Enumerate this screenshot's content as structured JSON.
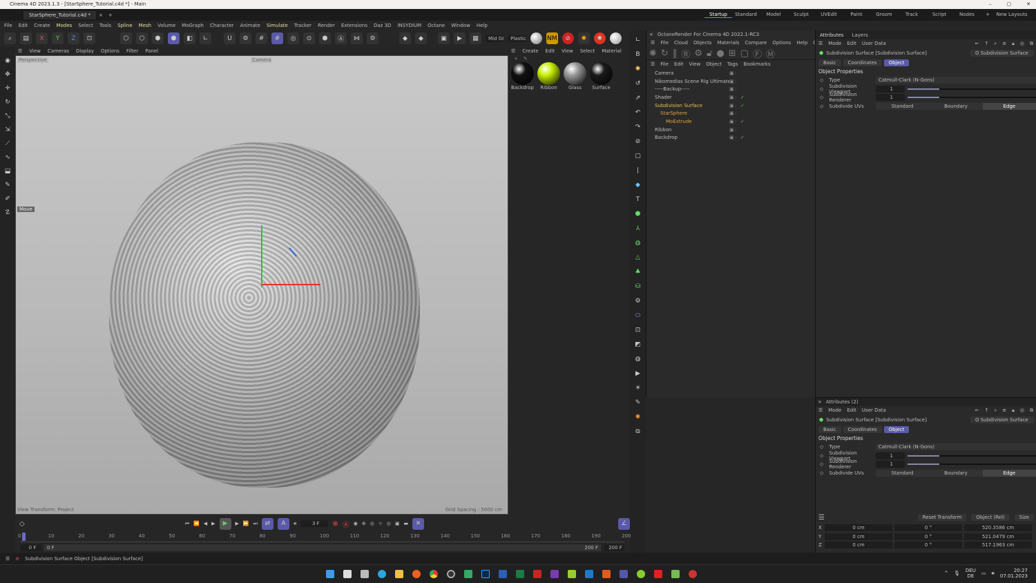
{
  "window": {
    "title": "Cinema 4D 2023.1.3 - [StarSphere_Tutorial.c4d *] - Main",
    "doc_tab": "StarSphere_Tutorial.c4d *"
  },
  "layouts": [
    "Startup",
    "Standard",
    "Model",
    "Sculpt",
    "UVEdit",
    "Paint",
    "Groom",
    "Track",
    "Script",
    "Nodes"
  ],
  "new_layouts": "New Layouts",
  "menu": [
    "File",
    "Edit",
    "Create",
    "Modes",
    "Select",
    "Tools",
    "Spline",
    "Mesh",
    "Volume",
    "MoGraph",
    "Character",
    "Animate",
    "Simulate",
    "Tracker",
    "Render",
    "Extensions",
    "Daz 3D",
    "INSYDIUM",
    "Octane",
    "Window",
    "Help"
  ],
  "toolbar": {
    "axes": [
      "X",
      "Y",
      "Z"
    ],
    "render_presets": [
      "Mid GI",
      "Plastic"
    ]
  },
  "viewport": {
    "menu": [
      "View",
      "Cameras",
      "Display",
      "Options",
      "Filter",
      "Panel"
    ],
    "view_label": "Perspective",
    "camera_label": "Camera",
    "tool_label": "Move",
    "view_transform": "View Transform: Project",
    "grid_spacing": "Grid Spacing : 5000 cm"
  },
  "materials": {
    "menu": [
      "Create",
      "Edit",
      "View",
      "Select",
      "Material"
    ],
    "items": [
      {
        "name": "Backdrop",
        "color": "#111111"
      },
      {
        "name": "Ribbon",
        "color": "#c8f000"
      },
      {
        "name": "Glass",
        "color": "#9a9a9a"
      },
      {
        "name": "Surface",
        "color": "#1a1a1a"
      }
    ]
  },
  "octane": {
    "title": "OctaneRender For Cinema 4D 2022.1-RC3",
    "menu": [
      "File",
      "Cloud",
      "Objects",
      "Materials",
      "Compare",
      "Options",
      "Help",
      "GUI"
    ]
  },
  "objects": {
    "menu": [
      "File",
      "Edit",
      "View",
      "Object",
      "Tags",
      "Bookmarks"
    ],
    "items": [
      {
        "name": "Camera",
        "style": ""
      },
      {
        "name": "Nikomedias Scene Rig Ultimate",
        "style": ""
      },
      {
        "name": "-----Backup-----",
        "style": ""
      },
      {
        "name": "Shader",
        "style": "",
        "check": "✓"
      },
      {
        "name": "Subdivision Surface",
        "style": "yellow",
        "check": "✓"
      },
      {
        "name": "StarSphere",
        "style": "orange"
      },
      {
        "name": "MoExtrude",
        "style": "orange",
        "check": "✓"
      },
      {
        "name": "Ribbon",
        "style": ""
      },
      {
        "name": "Backdrop",
        "style": "",
        "check": "✓"
      }
    ]
  },
  "attributes": {
    "tabs": [
      "Attributes",
      "Layers"
    ],
    "menu": [
      "Mode",
      "Edit",
      "User Data"
    ],
    "object_title": "Subdivision Surface [Subdivision Surface]",
    "object_select": "O Subdivision Surface",
    "sub_tabs": [
      "Basic",
      "Coordinates",
      "Object"
    ],
    "section": "Object Properties",
    "props": {
      "type_label": "Type",
      "type_value": "Catmull-Clark (N-Gons)",
      "viewport_label": "Subdivision Viewport",
      "viewport_value": "1",
      "renderer_label": "Subdivision Renderer",
      "renderer_value": "1",
      "uvs_label": "Subdivide UVs",
      "uvs_options": [
        "Standard",
        "Boundary",
        "Edge"
      ],
      "uvs_selected": "Edge"
    }
  },
  "attributes2": {
    "title": "Attributes (2)"
  },
  "coords": {
    "reset": "Reset Transform",
    "mode": "Object (Rel)",
    "size_mode": "Size",
    "rows": [
      {
        "axis": "X",
        "pos": "0 cm",
        "rot": "0 °",
        "size": "520.3586 cm"
      },
      {
        "axis": "Y",
        "pos": "0 cm",
        "rot": "0 °",
        "size": "521.0479 cm"
      },
      {
        "axis": "Z",
        "pos": "0 cm",
        "rot": "0 °",
        "size": "517.1963 cm"
      }
    ]
  },
  "timeline": {
    "current_frame": "3 F",
    "ticks": [
      "0",
      "10",
      "20",
      "30",
      "40",
      "50",
      "60",
      "70",
      "80",
      "90",
      "100",
      "110",
      "120",
      "130",
      "140",
      "150",
      "160",
      "170",
      "180",
      "190",
      "200"
    ],
    "start": "0 F",
    "range_start": "0 F",
    "range_end": "200 F",
    "end": "200 F"
  },
  "status": {
    "text": "Subdivision Surface Object [Subdivision Surface]"
  },
  "taskbar": {
    "lang1": "DEU",
    "lang2": "DE",
    "time": "20:27",
    "date": "07.01.2023"
  }
}
